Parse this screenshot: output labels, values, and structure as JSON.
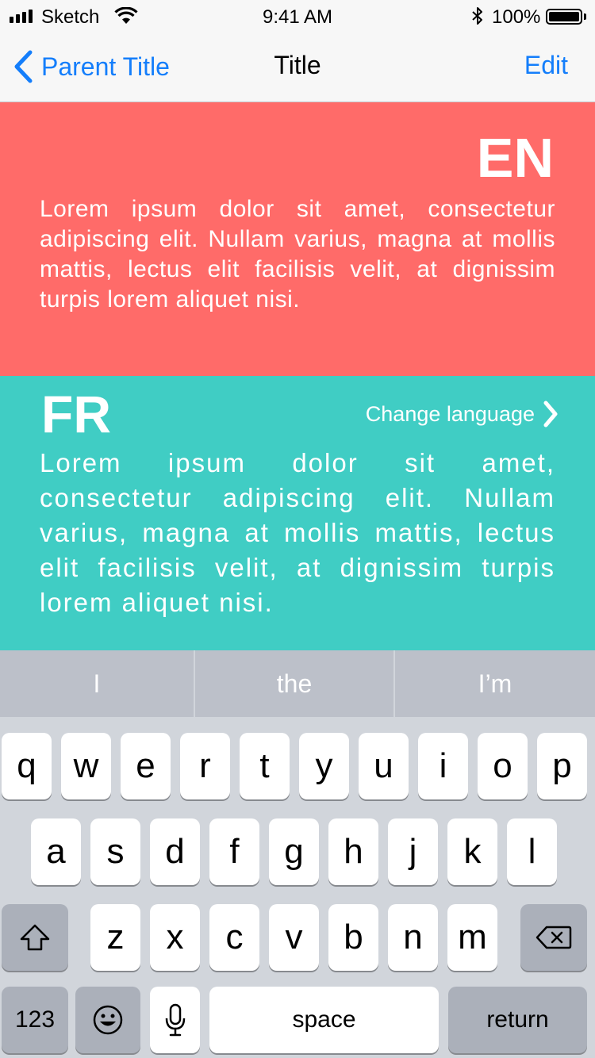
{
  "status_bar": {
    "carrier": "Sketch",
    "time": "9:41 AM",
    "battery": "100%"
  },
  "nav": {
    "back_label": "Parent Title",
    "title": "Title",
    "edit_label": "Edit"
  },
  "en_panel": {
    "code": "EN",
    "text": "Lorem ipsum dolor sit amet, consectetur adipiscing elit. Nullam varius, magna at mollis mattis, lectus elit facilisis velit, at dignissim turpis lorem aliquet nisi.",
    "color": "#ff6b69"
  },
  "fr_panel": {
    "code": "FR",
    "change_language": "Change language",
    "text": "Lorem ipsum dolor sit amet, consectetur adipiscing elit. Nullam varius, magna at mollis mattis, lectus elit facilisis velit, at dignissim turpis lorem aliquet nisi.",
    "color": "#40cdc4"
  },
  "keyboard": {
    "suggestions": [
      "I",
      "the",
      "I’m"
    ],
    "row1": [
      "q",
      "w",
      "e",
      "r",
      "t",
      "y",
      "u",
      "i",
      "o",
      "p"
    ],
    "row2": [
      "a",
      "s",
      "d",
      "f",
      "g",
      "h",
      "j",
      "k",
      "l"
    ],
    "row3": [
      "z",
      "x",
      "c",
      "v",
      "b",
      "n",
      "m"
    ],
    "numbers_label": "123",
    "space_label": "space",
    "return_label": "return",
    "shift_icon": "shift-icon",
    "delete_icon": "delete-icon",
    "emoji_icon": "emoji-icon",
    "mic_icon": "microphone-icon"
  }
}
